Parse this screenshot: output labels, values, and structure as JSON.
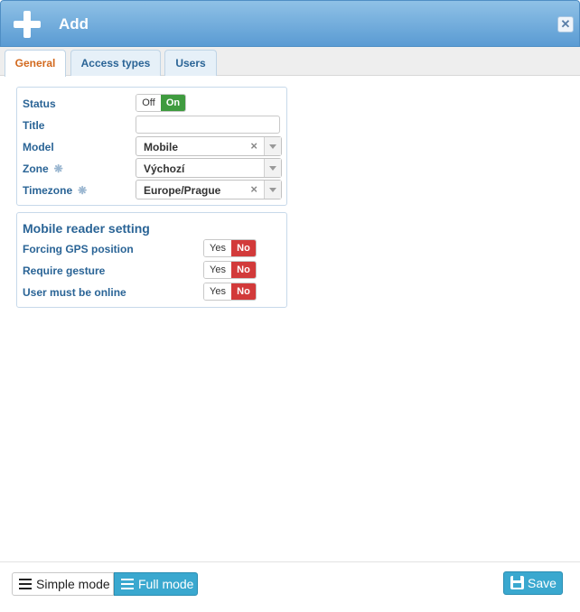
{
  "window": {
    "title": "Add",
    "close_icon": "close-icon",
    "add_icon": "plus-icon"
  },
  "tabs": [
    {
      "label": "General",
      "active": true
    },
    {
      "label": "Access types",
      "active": false
    },
    {
      "label": "Users",
      "active": false
    }
  ],
  "general": {
    "status": {
      "label": "Status",
      "off": "Off",
      "on": "On",
      "value": "On"
    },
    "title": {
      "label": "Title",
      "value": ""
    },
    "model": {
      "label": "Model",
      "value": "Mobile",
      "clear": "×"
    },
    "zone": {
      "label": "Zone",
      "value": "Výchozí",
      "required_mark": "❋"
    },
    "timezone": {
      "label": "Timezone",
      "value": "Europe/Prague",
      "required_mark": "❋",
      "clear": "×"
    }
  },
  "mobile_reader": {
    "title": "Mobile reader setting",
    "rows": [
      {
        "label": "Forcing GPS position",
        "yes": "Yes",
        "no": "No",
        "value": "No"
      },
      {
        "label": "Require gesture",
        "yes": "Yes",
        "no": "No",
        "value": "No"
      },
      {
        "label": "User must be online",
        "yes": "Yes",
        "no": "No",
        "value": "No"
      }
    ]
  },
  "footer": {
    "simple_mode": "Simple mode",
    "full_mode": "Full mode",
    "active_mode": "Full mode",
    "save": "Save"
  },
  "colors": {
    "accent": "#3aa8cf",
    "on": "#3f9b3f",
    "no": "#d23a3a",
    "label": "#2a6496",
    "active_tab": "#d2691e"
  }
}
